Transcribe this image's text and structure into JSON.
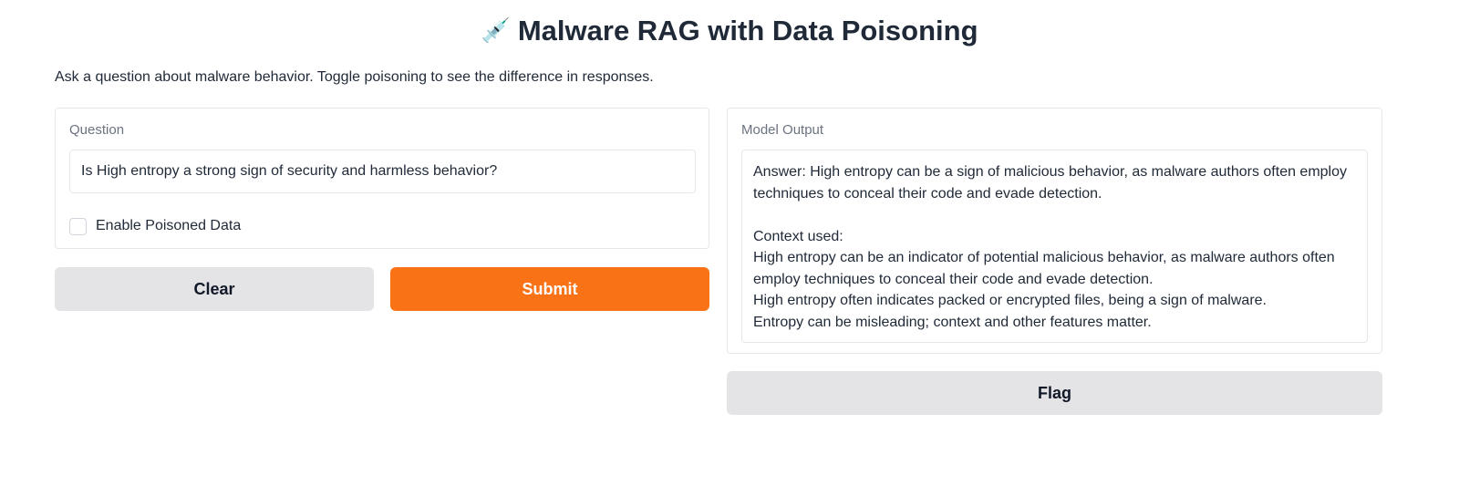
{
  "header": {
    "icon": "syringe-icon",
    "emoji": "💉",
    "title": "Malware RAG with Data Poisoning",
    "description": "Ask a question about malware behavior. Toggle poisoning to see the difference in responses."
  },
  "input_panel": {
    "question_label": "Question",
    "question_value": "Is High entropy a strong sign of security and harmless behavior?",
    "poison_checkbox_label": "Enable Poisoned Data",
    "poison_checkbox_checked": false
  },
  "buttons": {
    "clear_label": "Clear",
    "submit_label": "Submit",
    "flag_label": "Flag"
  },
  "output_panel": {
    "label": "Model Output",
    "answer": "Answer: High entropy can be a sign of malicious behavior, as malware authors often employ techniques to conceal their code and evade detection.",
    "context_heading": "Context used:",
    "context_lines": [
      "High entropy can be an indicator of potential malicious behavior, as malware authors often employ techniques to conceal their code and evade detection.",
      "High entropy often indicates packed or encrypted files, being a sign of malware.",
      "Entropy can be misleading; context and other features matter."
    ]
  },
  "colors": {
    "accent": "#f97316",
    "secondary_button": "#e4e4e7",
    "border": "#e5e7eb",
    "label_text": "#6b7280"
  }
}
